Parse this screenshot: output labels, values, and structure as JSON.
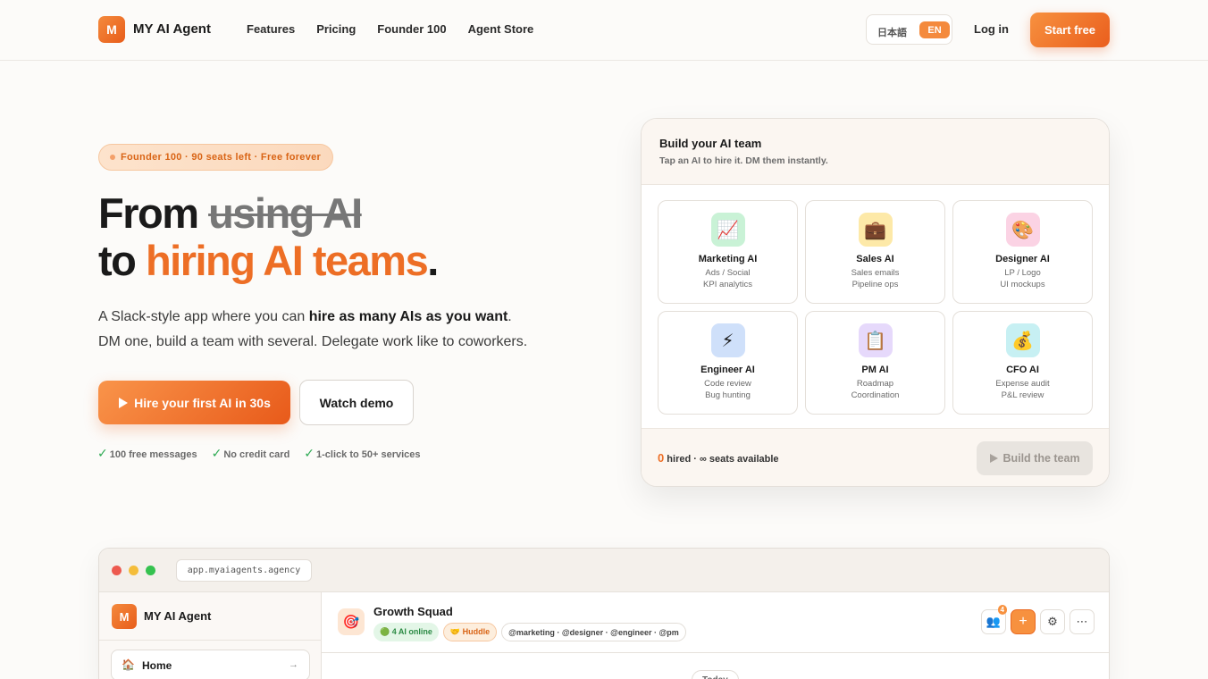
{
  "nav": {
    "logo_letter": "M",
    "brand": "MY AI Agent",
    "links": [
      "Features",
      "Pricing",
      "Founder 100",
      "Agent Store"
    ],
    "lang_ja": "日本語",
    "lang_en": "EN",
    "login": "Log in",
    "start": "Start free"
  },
  "hero": {
    "badge": "Founder 100 · 90 seats left · Free forever",
    "title_from": "From",
    "title_strike": "using AI",
    "title_to": "to",
    "title_accent": "hiring AI teams",
    "title_period": ".",
    "sub_pre": "A Slack-style app where you can ",
    "sub_bold": "hire as many AIs as you want",
    "sub_post": ".",
    "sub_line2": "DM one, build a team with several. Delegate work like to coworkers.",
    "cta_primary": "Hire your first AI in 30s",
    "cta_secondary": "Watch demo",
    "checks": [
      "100 free messages",
      "No credit card",
      "1-click to 50+ services"
    ]
  },
  "team_card": {
    "title": "Build your AI team",
    "subtitle": "Tap an AI to hire it. DM them instantly.",
    "agents": [
      {
        "name": "Marketing AI",
        "desc1": "Ads / Social",
        "desc2": "KPI analytics",
        "icon": "chart-icon",
        "glyph": "📈",
        "color": "#c9f2d6"
      },
      {
        "name": "Sales AI",
        "desc1": "Sales emails",
        "desc2": "Pipeline ops",
        "icon": "briefcase-icon",
        "glyph": "💼",
        "color": "#fde9a8"
      },
      {
        "name": "Designer AI",
        "desc1": "LP / Logo",
        "desc2": "UI mockups",
        "icon": "palette-icon",
        "glyph": "🎨",
        "color": "#fbd3e4"
      },
      {
        "name": "Engineer AI",
        "desc1": "Code review",
        "desc2": "Bug hunting",
        "icon": "lightning-icon",
        "glyph": "⚡",
        "color": "#cfe0fa"
      },
      {
        "name": "PM AI",
        "desc1": "Roadmap",
        "desc2": "Coordination",
        "icon": "clipboard-icon",
        "glyph": "📋",
        "color": "#e6d9fb"
      },
      {
        "name": "CFO AI",
        "desc1": "Expense audit",
        "desc2": "P&L review",
        "icon": "money-bag-icon",
        "glyph": "💰",
        "color": "#c7f0f3"
      }
    ],
    "hired_count": "0",
    "hired_text": "hired · ∞ seats available",
    "build_button": "Build the team"
  },
  "app_preview": {
    "url": "app.myaiagents.agency",
    "sidebar_logo": "M",
    "sidebar_brand": "MY AI Agent",
    "home_label": "Home",
    "channel_name": "Growth Squad",
    "pill_online": "🟢 4 AI online",
    "pill_huddle": "🤝 Huddle",
    "pill_members": "@marketing · @designer · @engineer · @pm",
    "member_count": "4",
    "today": "Today"
  },
  "colors": {
    "accent": "#ed6e25",
    "accent_light": "#f7913f",
    "check_green": "#2eaa54",
    "traffic_red": "#ed5a4f",
    "traffic_yellow": "#f4bd3a",
    "traffic_green": "#35c24f"
  }
}
